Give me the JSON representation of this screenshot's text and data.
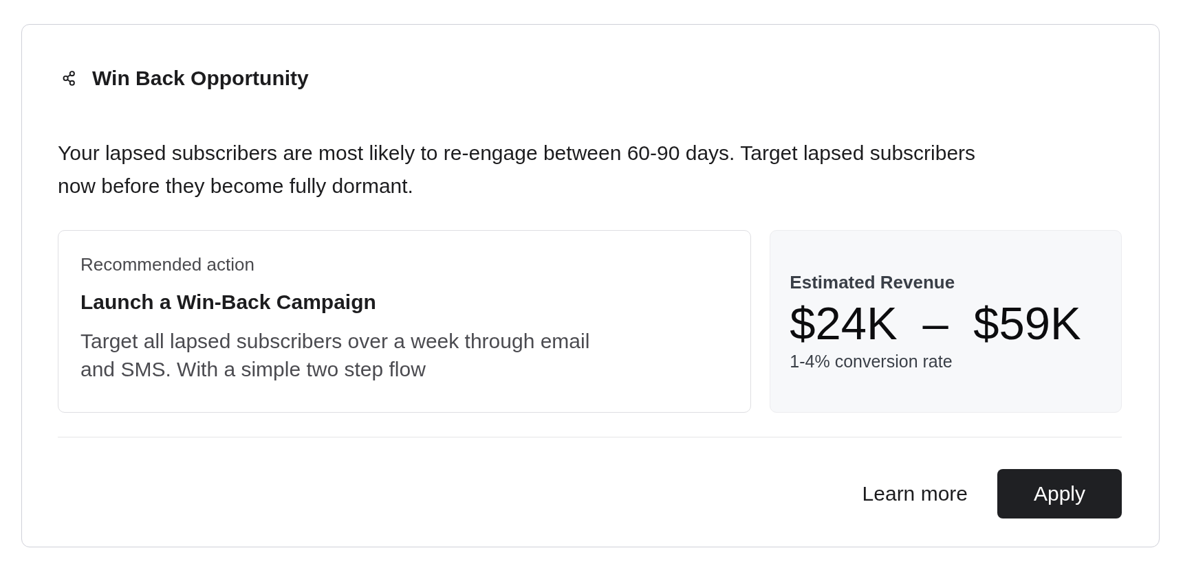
{
  "card": {
    "title": "Win Back Opportunity",
    "description": "Your lapsed subscribers are most likely to re-engage between 60-90 days. Target lapsed subscribers now before they become fully dormant.",
    "recommendation": {
      "label": "Recommended action",
      "title": "Launch a Win-Back Campaign",
      "description": "Target all lapsed subscribers over a week through email and SMS. With a simple two step flow"
    },
    "estimate": {
      "label": "Estimated Revenue",
      "value": "$24K – $59K",
      "note": "1-4% conversion rate"
    },
    "actions": [
      {
        "label": "Learn more",
        "kind": "link"
      },
      {
        "label": "Apply",
        "kind": "primary"
      }
    ]
  }
}
